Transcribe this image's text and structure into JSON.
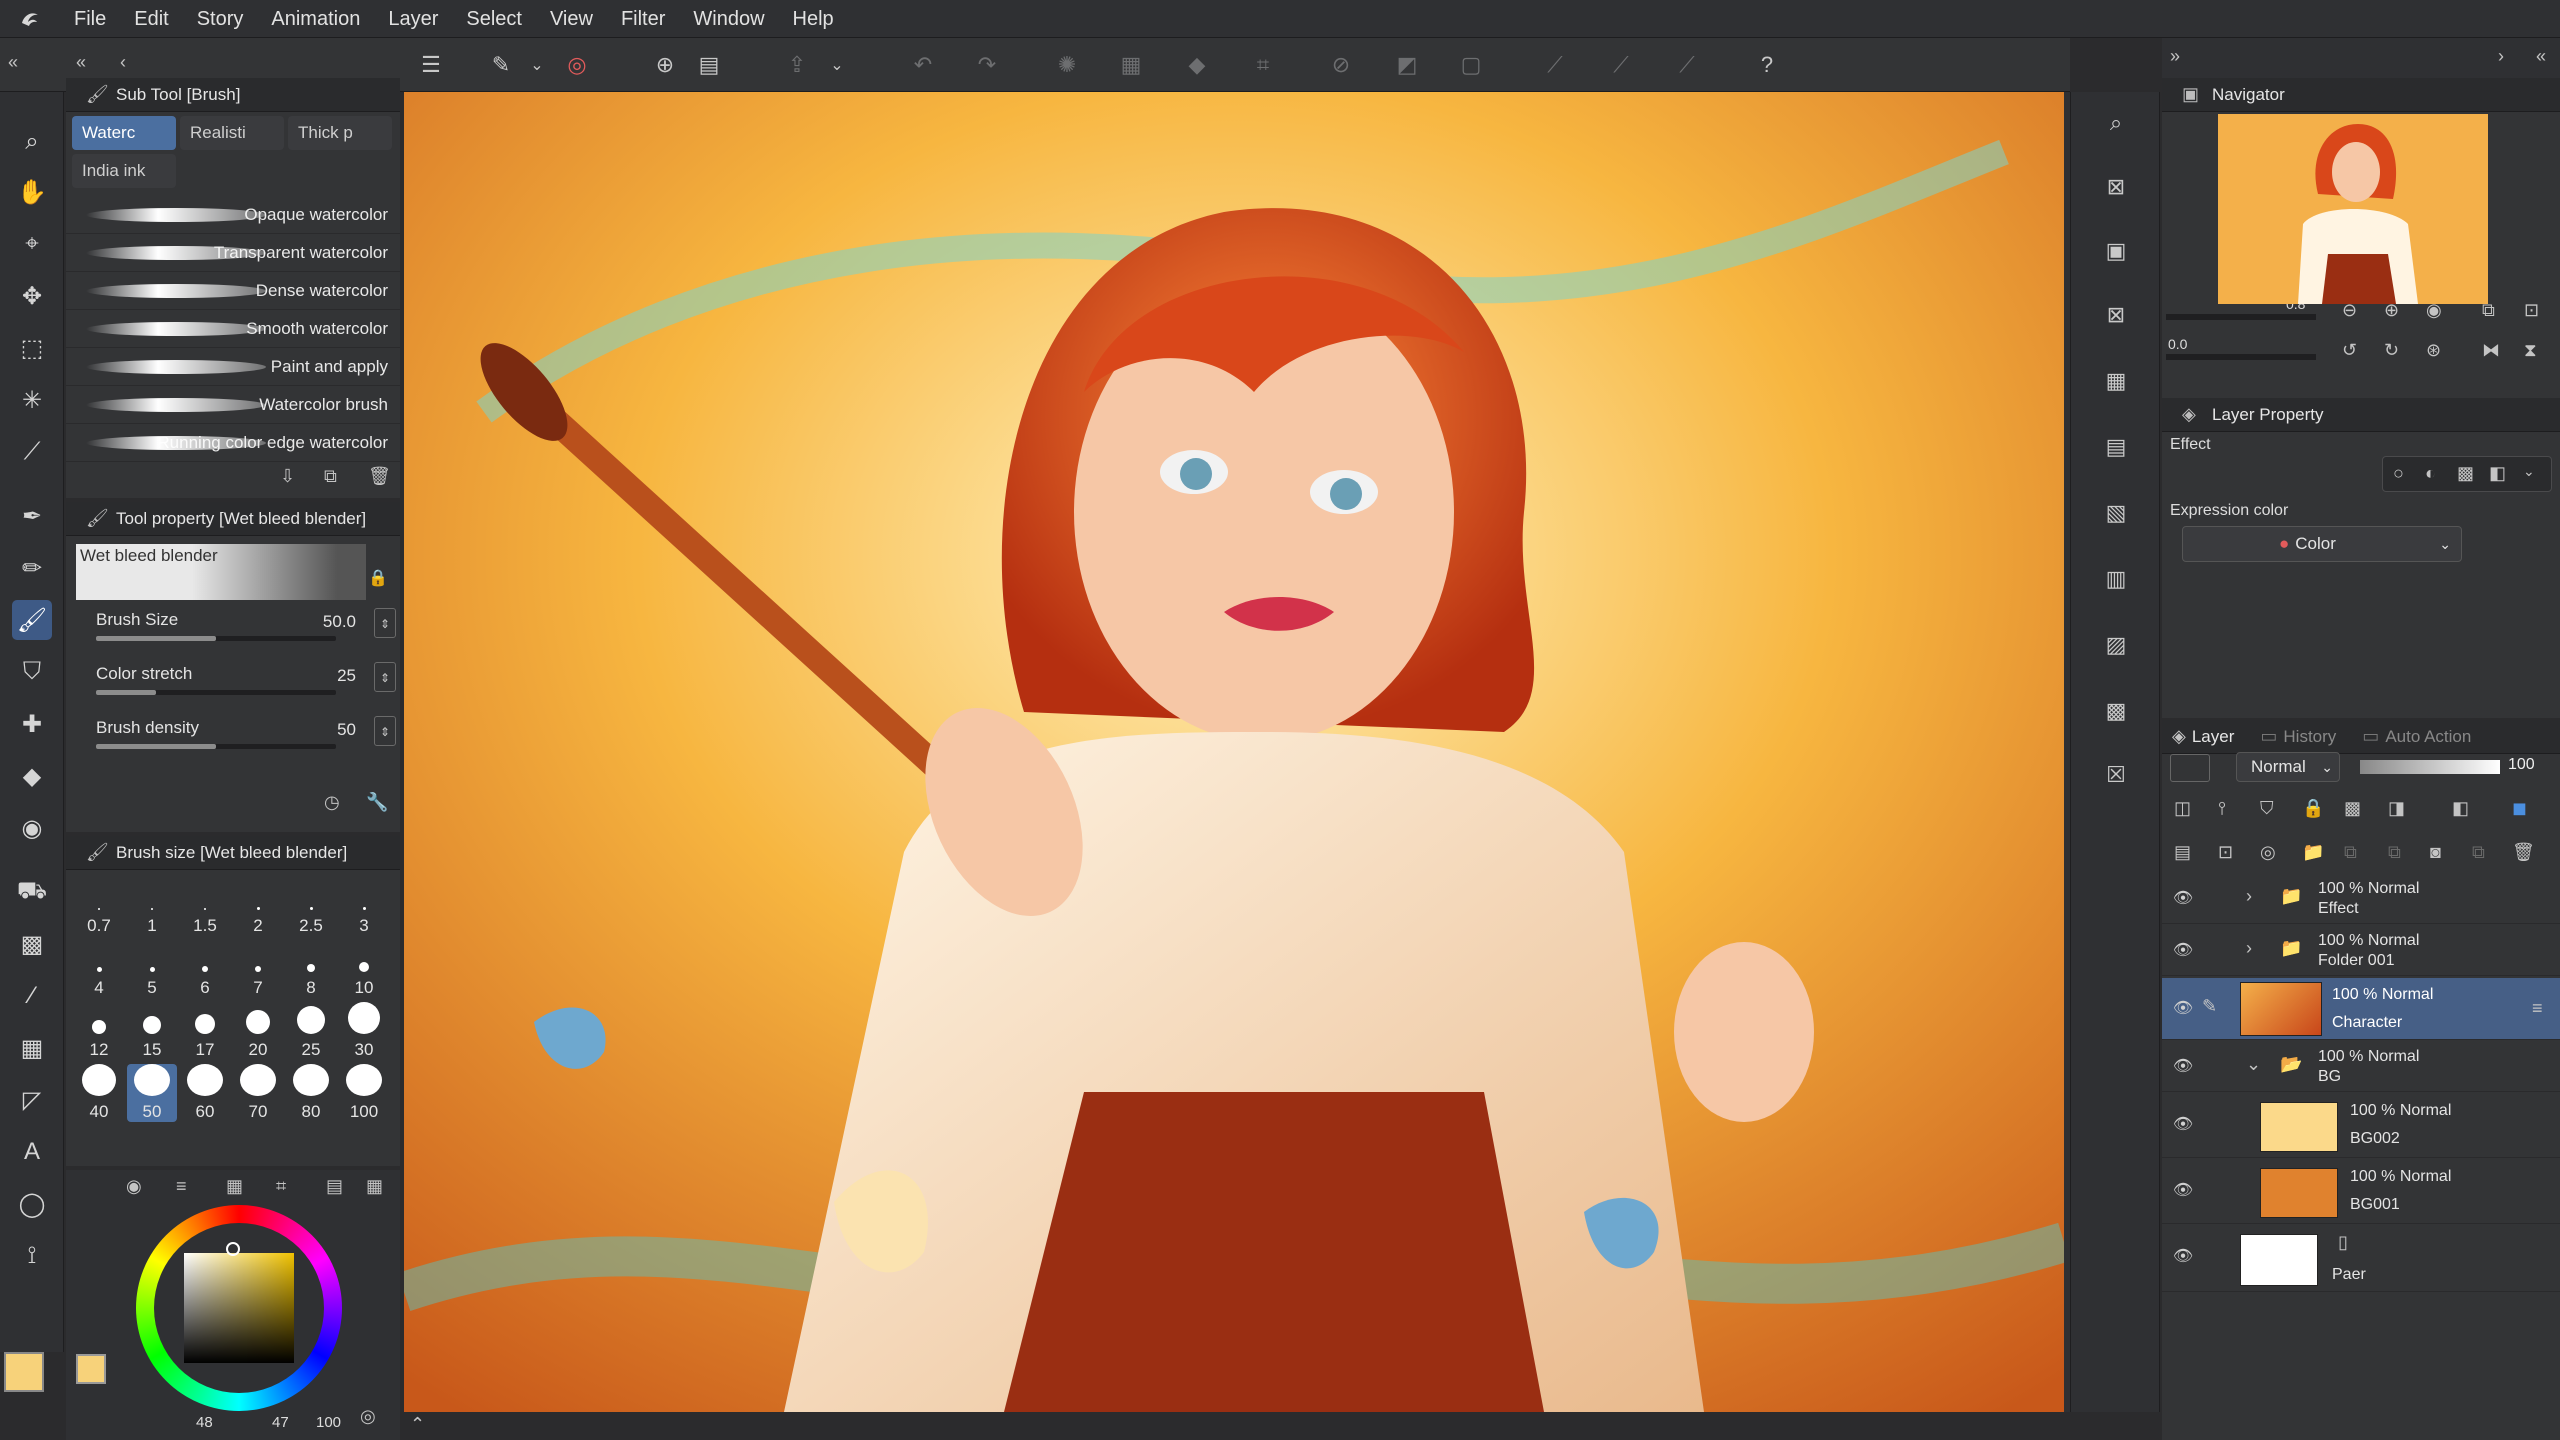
{
  "menu": {
    "items": [
      "File",
      "Edit",
      "Story",
      "Animation",
      "Layer",
      "Select",
      "View",
      "Filter",
      "Window",
      "Help"
    ]
  },
  "subtool": {
    "header": "Sub Tool [Brush]",
    "tabs": [
      "Waterc",
      "Realisti",
      "Thick p",
      "India ink"
    ],
    "brushes": [
      "Opaque watercolor",
      "Transparent watercolor",
      "Dense watercolor",
      "Smooth watercolor",
      "Paint and apply",
      "Watercolor brush",
      "Running color edge watercolor"
    ]
  },
  "toolprop": {
    "header": "Tool property [Wet bleed blender]",
    "preview_label": "Wet bleed blender",
    "sliders": [
      {
        "label": "Brush Size",
        "value": "50.0",
        "fill": 0.5
      },
      {
        "label": "Color stretch",
        "value": "25",
        "fill": 0.25
      },
      {
        "label": "Brush density",
        "value": "50",
        "fill": 0.5
      }
    ]
  },
  "brushsize": {
    "header": "Brush size [Wet bleed blender]",
    "sizes": [
      "0.7",
      "1",
      "1.5",
      "2",
      "2.5",
      "3",
      "4",
      "5",
      "6",
      "7",
      "8",
      "10",
      "12",
      "15",
      "17",
      "20",
      "25",
      "30",
      "40",
      "50",
      "60",
      "70",
      "80",
      "100"
    ],
    "selected": "50"
  },
  "color": {
    "readout_1": "48",
    "readout_2": "47",
    "readout_3": "100",
    "main": "#f7d27a",
    "sub": "#e0502a"
  },
  "navigator": {
    "title": "Navigator",
    "zoom": "0.8",
    "rotation": "0.0"
  },
  "layerprop": {
    "title": "Layer Property",
    "effect_label": "Effect",
    "expression_label": "Expression color",
    "expression_value": "Color"
  },
  "layers": {
    "tabs": [
      "Layer",
      "History",
      "Auto Action"
    ],
    "blend_mode": "Normal",
    "opacity": "100",
    "rows": [
      {
        "mode": "100 % Normal",
        "name": "Effect",
        "type": "folder"
      },
      {
        "mode": "100 % Normal",
        "name": "Folder 001",
        "type": "folder"
      },
      {
        "mode": "100 % Normal",
        "name": "Character",
        "type": "raster",
        "selected": true
      },
      {
        "mode": "100 % Normal",
        "name": "BG",
        "type": "folder-open"
      },
      {
        "mode": "100 % Normal",
        "name": "BG002",
        "type": "fill",
        "color": "#fbd98a"
      },
      {
        "mode": "100 % Normal",
        "name": "BG001",
        "type": "fill",
        "color": "#e0822e"
      },
      {
        "mode": "",
        "name": "Paer",
        "type": "paper",
        "color": "#ffffff"
      }
    ]
  },
  "icons": {
    "app": "clip-studio-logo-icon"
  }
}
